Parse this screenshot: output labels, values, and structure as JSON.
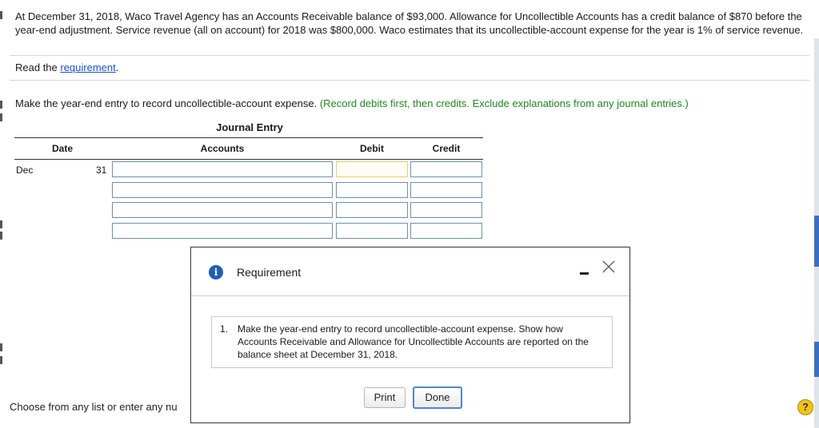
{
  "problem": {
    "text": "At December 31, 2018, Waco Travel Agency has an Accounts Receivable balance of $93,000. Allowance for Uncollectible Accounts has a credit balance of $870 before the year-end adjustment. Service revenue (all on account) for 2018 was $800,000. Waco estimates that its uncollectible-account expense for the year is 1% of service revenue."
  },
  "read_requirement": {
    "prefix": "Read the ",
    "link": "requirement",
    "suffix": "."
  },
  "instruction": {
    "main": "Make the year-end entry to record uncollectible-account expense.",
    "hint": "(Record debits first, then credits. Exclude explanations from any journal entries.)"
  },
  "journal": {
    "title": "Journal Entry",
    "headers": {
      "date": "Date",
      "accounts": "Accounts",
      "debit": "Debit",
      "credit": "Credit"
    },
    "month": "Dec",
    "day": "31",
    "rows": [
      {
        "account": "",
        "debit": "",
        "credit": ""
      },
      {
        "account": "",
        "debit": "",
        "credit": ""
      },
      {
        "account": "",
        "debit": "",
        "credit": ""
      },
      {
        "account": "",
        "debit": "",
        "credit": ""
      }
    ]
  },
  "footer": {
    "choose_text": "Choose from any list or enter any nu"
  },
  "modal": {
    "title": "Requirement",
    "requirement_number": "1.",
    "requirement_text": "Make the year-end entry to record uncollectible-account expense. Show how Accounts Receivable and Allowance for Uncollectible Accounts are reported on the balance sheet at December 31, 2018.",
    "print_label": "Print",
    "done_label": "Done",
    "info_glyph": "i",
    "icons": [
      "info-icon",
      "minimize-icon",
      "close-icon"
    ]
  },
  "help": {
    "glyph": "?",
    "icon": "help-icon"
  },
  "colors": {
    "link": "#1a4fd6",
    "hint": "#1c8a1c",
    "info": "#1e5fb4",
    "help": "#f3c316",
    "active_cell": "#e9cf6e"
  }
}
